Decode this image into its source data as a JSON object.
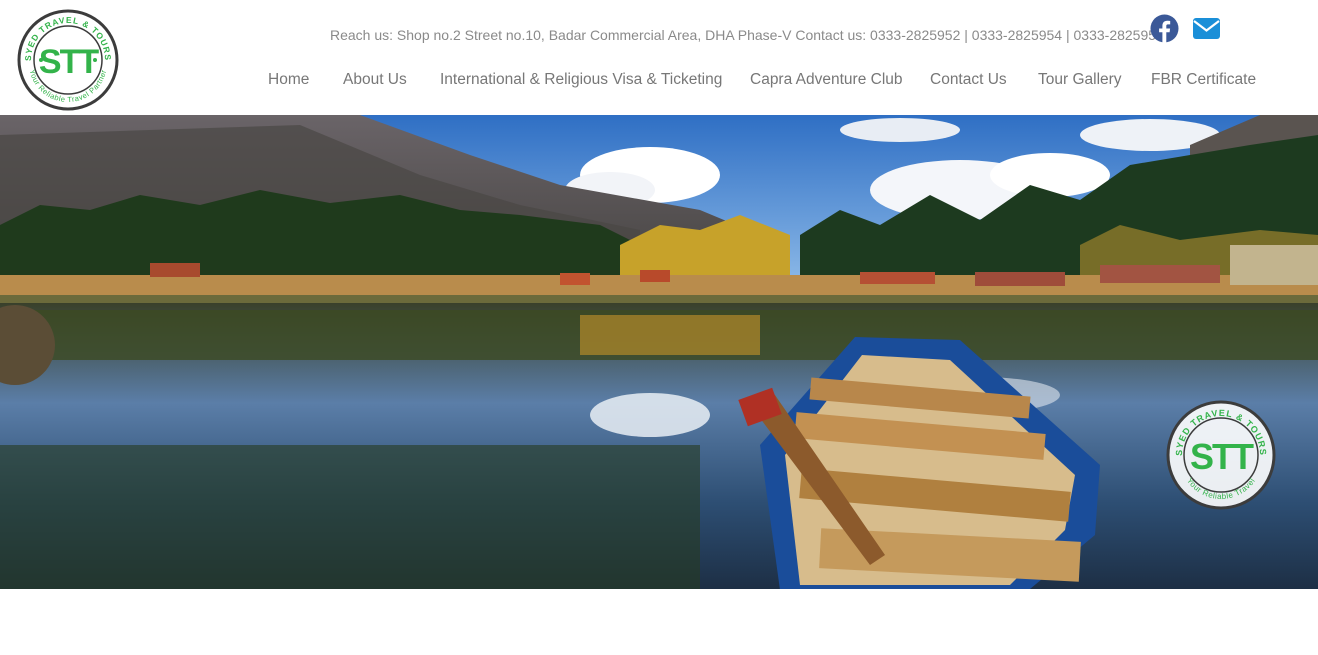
{
  "brand": {
    "logo_ring_text": "SYED TRAVEL & TOURS",
    "logo_tagline": "Your Reliable Travel Partner",
    "logo_mark": "STT",
    "colors": {
      "green": "#33b34a",
      "ring": "#3c3c3c"
    }
  },
  "topbar": {
    "contact_line": "Reach us: Shop no.2 Street no.10, Badar Commercial Area, DHA Phase-V Contact us: 0333-2825952 | 0333-2825954 | 0333-2825950",
    "social": [
      {
        "name": "facebook-icon",
        "color": "#3b5998"
      },
      {
        "name": "envelope-icon",
        "color": "#1a8fd8"
      }
    ]
  },
  "nav": {
    "items": [
      {
        "label": "Home"
      },
      {
        "label": "About Us"
      },
      {
        "label": "International & Religious Visa & Ticketing"
      },
      {
        "label": "Capra Adventure Club"
      },
      {
        "label": "Contact Us"
      },
      {
        "label": "Tour Gallery"
      },
      {
        "label": "FBR Certificate"
      }
    ]
  },
  "hero": {
    "badge_ring_text": "SYED TRAVEL & TOURS",
    "badge_tagline": "Your Reliable Travel",
    "badge_mark": "STT"
  }
}
